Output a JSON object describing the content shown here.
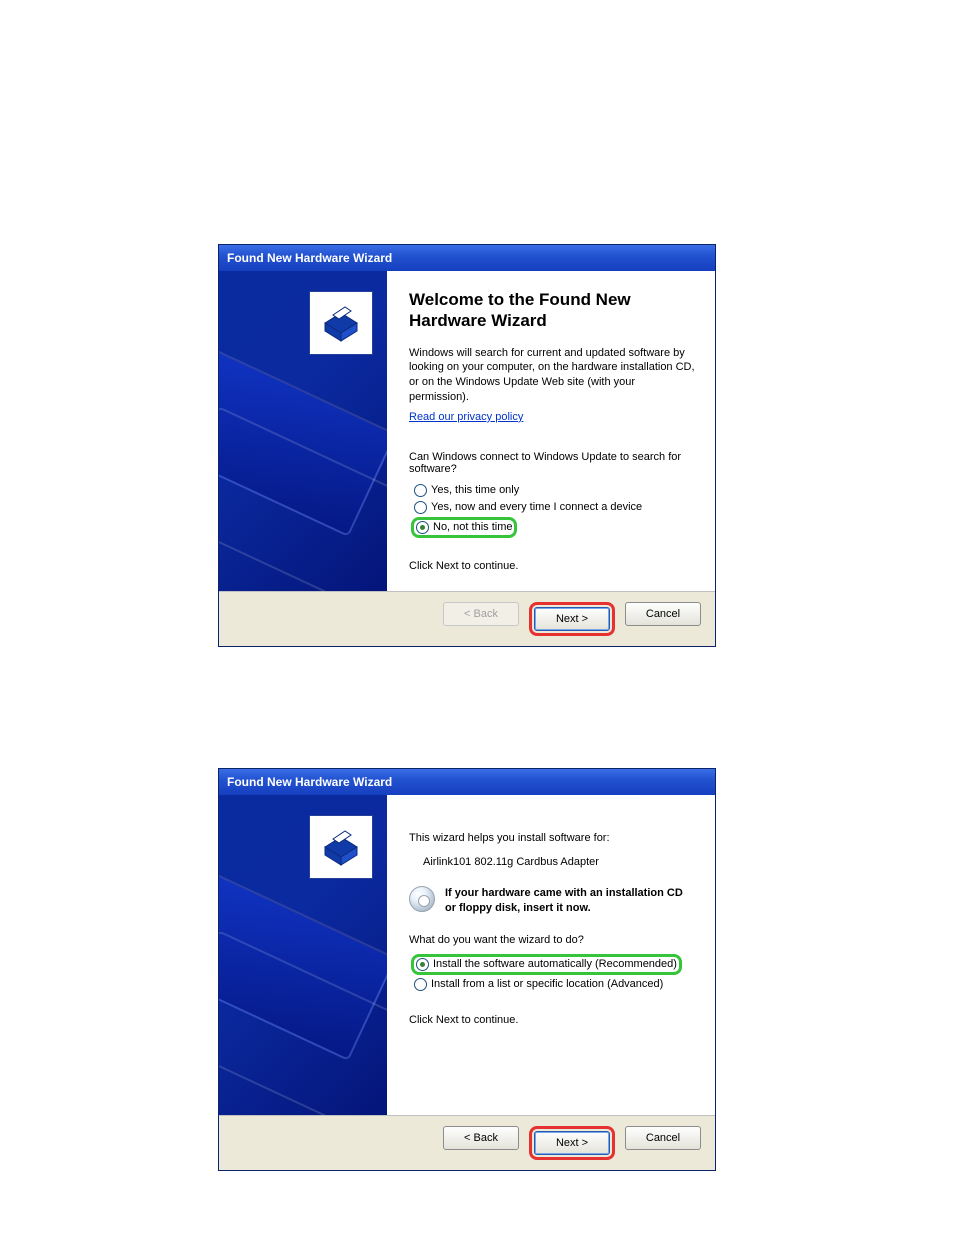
{
  "dialog1": {
    "title": "Found New Hardware Wizard",
    "heading": "Welcome to the Found New Hardware Wizard",
    "intro": "Windows will search for current and updated software by looking on your computer, on the hardware installation CD, or on the Windows Update Web site (with your permission).",
    "privacy_link": "Read our privacy policy",
    "question": "Can Windows connect to Windows Update to search for software?",
    "options": {
      "opt1": "Yes, this time only",
      "opt2": "Yes, now and every time I connect a device",
      "opt3": "No, not this time"
    },
    "continue": "Click Next to continue.",
    "buttons": {
      "back": "< Back",
      "next": "Next >",
      "cancel": "Cancel"
    }
  },
  "dialog2": {
    "title": "Found New Hardware Wizard",
    "intro": "This wizard helps you install software for:",
    "device": "Airlink101 802.11g Cardbus Adapter",
    "cd_note": "If your hardware came with an installation CD or floppy disk, insert it now.",
    "question": "What do you want the wizard to do?",
    "options": {
      "opt1": "Install the software automatically (Recommended)",
      "opt2": "Install from a list or specific location (Advanced)"
    },
    "continue": "Click Next to continue.",
    "buttons": {
      "back": "< Back",
      "next": "Next >",
      "cancel": "Cancel"
    }
  }
}
